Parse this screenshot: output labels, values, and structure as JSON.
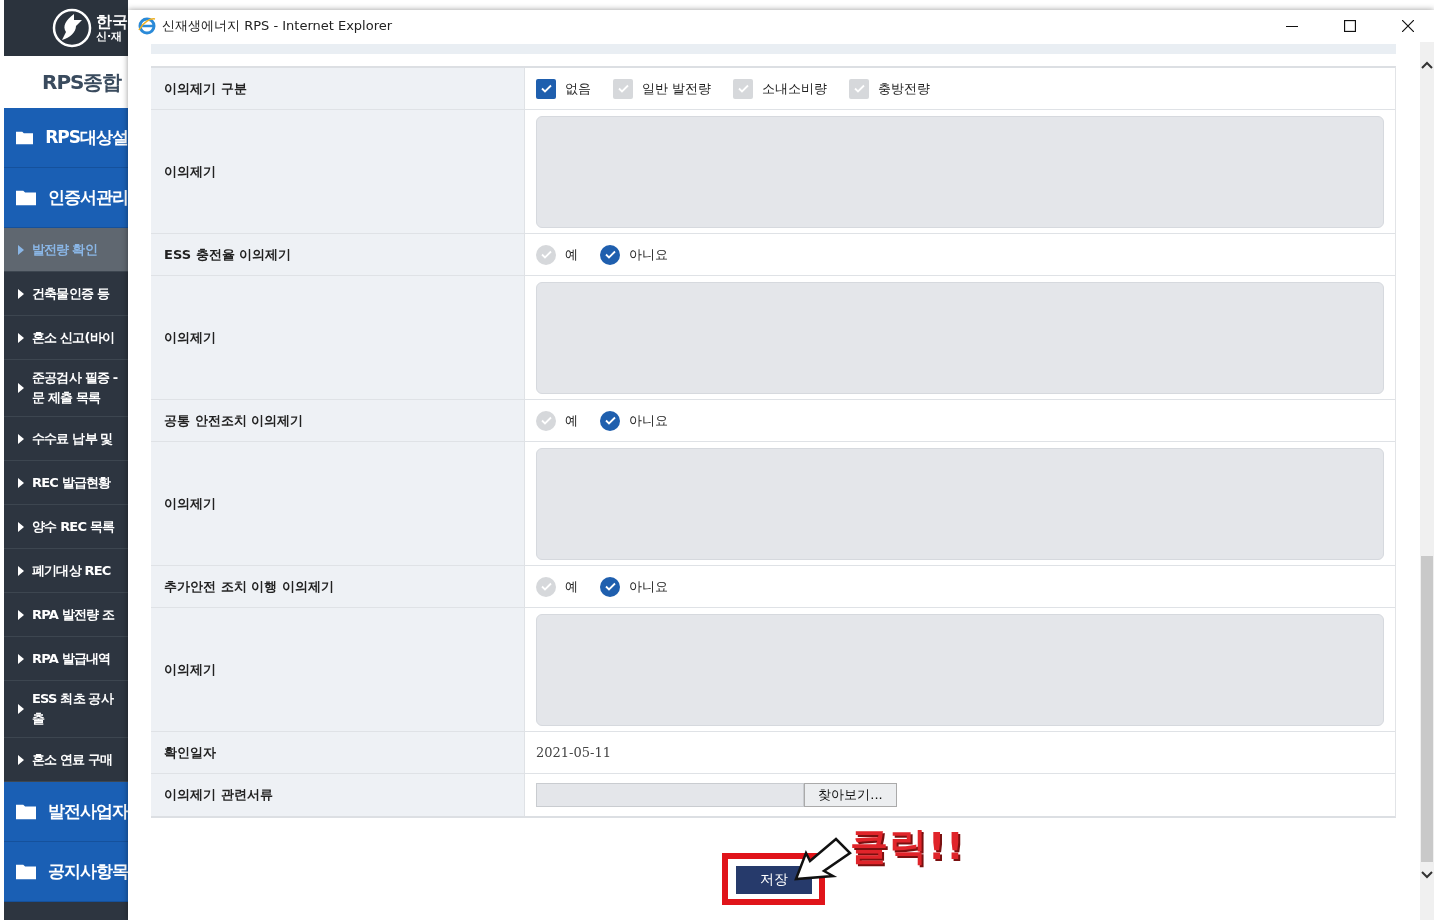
{
  "background_page": {
    "logo_lines": [
      "한국",
      "신·재"
    ],
    "site_title": "RPS종합",
    "menu": [
      {
        "kind": "folder",
        "lines": [
          "RPS대상설"
        ]
      },
      {
        "kind": "folder",
        "lines": [
          "인증서관리"
        ]
      },
      {
        "kind": "sub",
        "lines": [
          "발전량 확인"
        ],
        "selected": true
      },
      {
        "kind": "sub",
        "lines": [
          "건축물인증 등"
        ],
        "selected": false
      },
      {
        "kind": "sub",
        "lines": [
          "혼소 신고(바이"
        ],
        "selected": false
      },
      {
        "kind": "sub",
        "lines": [
          "준공검사 필증 -",
          "문 제출 목록"
        ],
        "selected": false
      },
      {
        "kind": "sub",
        "lines": [
          "수수료 납부 및"
        ],
        "selected": false
      },
      {
        "kind": "sub",
        "lines": [
          "REC 발급현황"
        ],
        "selected": false
      },
      {
        "kind": "sub",
        "lines": [
          "양수 REC 목록"
        ],
        "selected": false
      },
      {
        "kind": "sub",
        "lines": [
          "폐기대상 REC"
        ],
        "selected": false
      },
      {
        "kind": "sub",
        "lines": [
          "RPA 발전량 조"
        ],
        "selected": false
      },
      {
        "kind": "sub",
        "lines": [
          "RPA 발급내역"
        ],
        "selected": false
      },
      {
        "kind": "sub",
        "lines": [
          "ESS 최초 공사",
          "출"
        ],
        "selected": false
      },
      {
        "kind": "sub",
        "lines": [
          "혼소 연료 구매"
        ],
        "selected": false
      },
      {
        "kind": "folder",
        "lines": [
          "발전사업자"
        ]
      },
      {
        "kind": "folder",
        "lines": [
          "공지사항목"
        ]
      }
    ]
  },
  "window": {
    "title": "신재생에너지 RPS - Internet Explorer"
  },
  "form": {
    "rows": [
      {
        "kind": "checkboxes",
        "label": "이의제기 구분",
        "options": [
          {
            "label": "없음",
            "checked": true
          },
          {
            "label": "일반 발전량",
            "checked": false
          },
          {
            "label": "소내소비량",
            "checked": false
          },
          {
            "label": "충방전량",
            "checked": false
          }
        ]
      },
      {
        "kind": "textarea",
        "label": "이의제기"
      },
      {
        "kind": "radios",
        "label": "ESS 충전율 이의제기",
        "options": [
          {
            "label": "예",
            "selected": false
          },
          {
            "label": "아니요",
            "selected": true
          }
        ]
      },
      {
        "kind": "textarea",
        "label": "이의제기"
      },
      {
        "kind": "radios",
        "label": "공통 안전조치 이의제기",
        "options": [
          {
            "label": "예",
            "selected": false
          },
          {
            "label": "아니요",
            "selected": true
          }
        ]
      },
      {
        "kind": "textarea",
        "label": "이의제기"
      },
      {
        "kind": "radios",
        "label": "추가안전 조치 이행 이의제기",
        "options": [
          {
            "label": "예",
            "selected": false
          },
          {
            "label": "아니요",
            "selected": true
          }
        ]
      },
      {
        "kind": "textarea",
        "label": "이의제기"
      },
      {
        "kind": "text",
        "label": "확인일자",
        "value": "2021-05-11"
      },
      {
        "kind": "file",
        "label": "이의제기 관련서류",
        "button": "찾아보기..."
      }
    ]
  },
  "save_button": "저장",
  "annotation": {
    "text": "클릭!!"
  }
}
